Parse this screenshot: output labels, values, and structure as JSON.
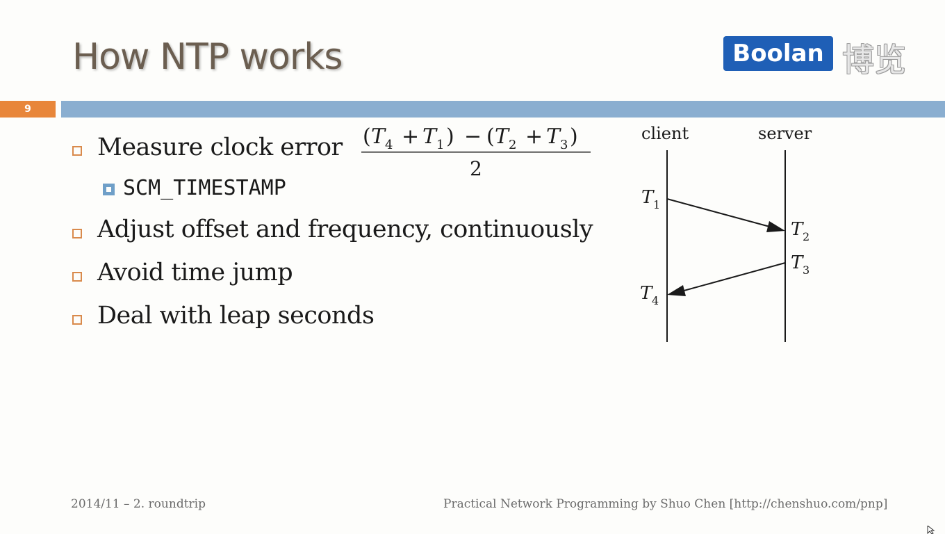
{
  "slide": {
    "title": "How NTP works",
    "number": "9",
    "logo": {
      "brand": "Boolan",
      "chinese": "博览",
      "brand_color": "#1f5fb6"
    },
    "accent_color": "#e8863a",
    "bar_color": "#8aaed0"
  },
  "bullets": [
    {
      "text": "Measure clock error",
      "sub": [
        "SCM_TIMESTAMP"
      ]
    },
    {
      "text": "Adjust offset and frequency, continuously"
    },
    {
      "text": "Avoid time jump"
    },
    {
      "text": "Deal with leap seconds"
    }
  ],
  "formula": {
    "numerator": "(T4 + T1) − (T2 + T3)",
    "denominator": "2"
  },
  "diagram": {
    "client_label": "client",
    "server_label": "server",
    "timestamps": [
      "T1",
      "T2",
      "T3",
      "T4"
    ]
  },
  "footer": {
    "left": "2014/11 – 2. roundtrip",
    "right": "Practical Network Programming by Shuo Chen [http://chenshuo.com/pnp]"
  }
}
